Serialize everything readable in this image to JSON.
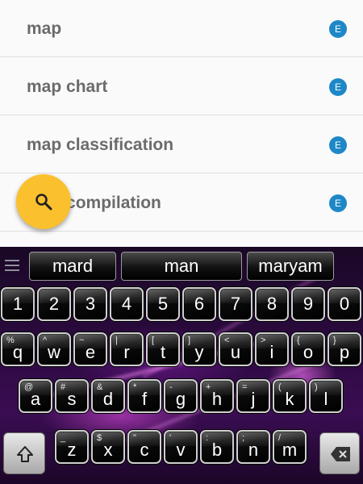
{
  "results": [
    {
      "label": "map",
      "badge": "E"
    },
    {
      "label": "map chart",
      "badge": "E"
    },
    {
      "label": "map classification",
      "badge": "E"
    },
    {
      "label": "map compilation",
      "badge": "E"
    }
  ],
  "fab": {
    "icon": "search-icon"
  },
  "keyboard": {
    "suggestions": [
      "mard",
      "man",
      "maryam"
    ],
    "number_row": [
      "1",
      "2",
      "3",
      "4",
      "5",
      "6",
      "7",
      "8",
      "9",
      "0"
    ],
    "row1": [
      {
        "main": "q",
        "alt": "%"
      },
      {
        "main": "w",
        "alt": "^"
      },
      {
        "main": "e",
        "alt": "~"
      },
      {
        "main": "r",
        "alt": "|"
      },
      {
        "main": "t",
        "alt": "["
      },
      {
        "main": "y",
        "alt": "]"
      },
      {
        "main": "u",
        "alt": "<"
      },
      {
        "main": "i",
        "alt": ">"
      },
      {
        "main": "o",
        "alt": "{"
      },
      {
        "main": "p",
        "alt": "}"
      }
    ],
    "row2": [
      {
        "main": "a",
        "alt": "@"
      },
      {
        "main": "s",
        "alt": "#"
      },
      {
        "main": "d",
        "alt": "&"
      },
      {
        "main": "f",
        "alt": "*"
      },
      {
        "main": "g",
        "alt": "-"
      },
      {
        "main": "h",
        "alt": "+"
      },
      {
        "main": "j",
        "alt": "="
      },
      {
        "main": "k",
        "alt": "("
      },
      {
        "main": "l",
        "alt": ")"
      }
    ],
    "row3": [
      {
        "main": "z",
        "alt": "_"
      },
      {
        "main": "x",
        "alt": "$"
      },
      {
        "main": "c",
        "alt": "\""
      },
      {
        "main": "v",
        "alt": "'"
      },
      {
        "main": "b",
        "alt": ":"
      },
      {
        "main": "n",
        "alt": ";"
      },
      {
        "main": "m",
        "alt": "/"
      }
    ],
    "shift_icon": "shift-arrow-icon",
    "delete_icon": "backspace-icon"
  }
}
